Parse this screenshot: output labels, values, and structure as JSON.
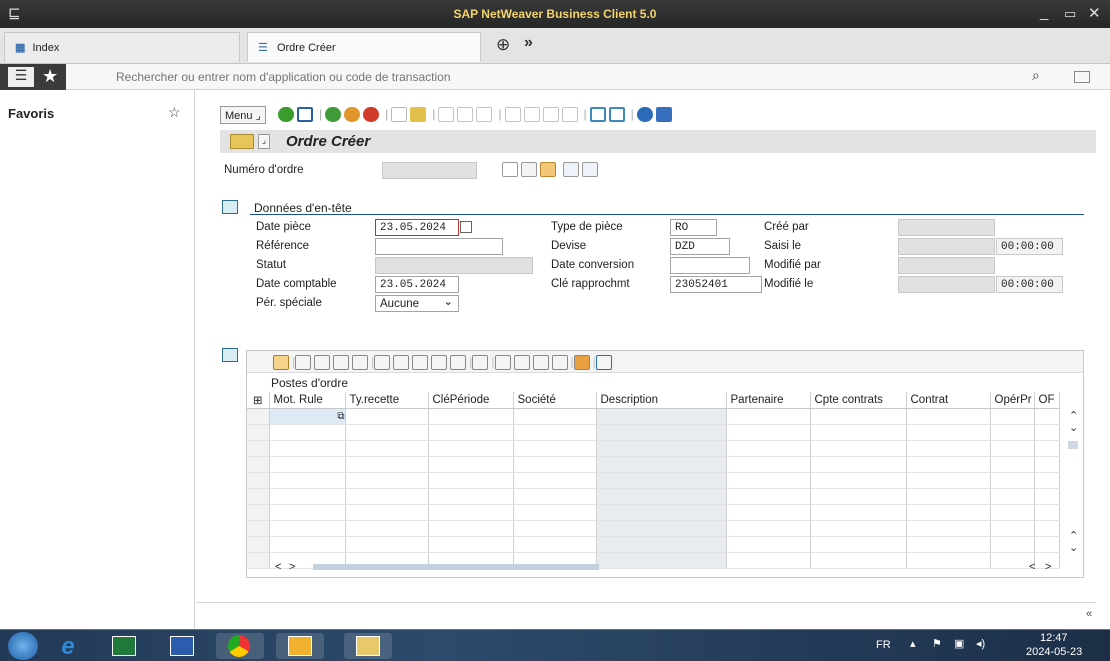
{
  "window": {
    "title": "SAP NetWeaver Business Client 5.0"
  },
  "tabs": [
    {
      "label": "Index"
    },
    {
      "label": "Ordre Créer"
    }
  ],
  "search": {
    "placeholder": "Rechercher ou entrer nom d'application ou code de transaction"
  },
  "sidebar": {
    "title": "Favoris"
  },
  "toolbar": {
    "menu_label": "Menu"
  },
  "page": {
    "title": "Ordre Créer"
  },
  "order": {
    "number_label": "Numéro d'ordre",
    "number_value": ""
  },
  "header": {
    "section_title": "Données d'en-tête",
    "date_piece_label": "Date pièce",
    "date_piece_value": "23.05.2024",
    "reference_label": "Référence",
    "reference_value": "",
    "statut_label": "Statut",
    "statut_value": "",
    "date_comptable_label": "Date comptable",
    "date_comptable_value": "23.05.2024",
    "per_speciale_label": "Pér. spéciale",
    "per_speciale_value": "Aucune",
    "type_piece_label": "Type de pièce",
    "type_piece_value": "RO",
    "devise_label": "Devise",
    "devise_value": "DZD",
    "date_conversion_label": "Date conversion",
    "date_conversion_value": "",
    "cle_rapprochmt_label": "Clé rapprochmt",
    "cle_rapprochmt_value": "23052401",
    "cree_par_label": "Créé par",
    "cree_par_value": "",
    "saisi_le_label": "Saisi le",
    "saisi_le_value": "",
    "saisi_le_time": "00:00:00",
    "modifie_par_label": "Modifié par",
    "modifie_par_value": "",
    "modifie_le_label": "Modifié le",
    "modifie_le_value": "",
    "modifie_le_time": "00:00:00"
  },
  "items": {
    "title": "Postes d'ordre",
    "columns": [
      "Mot. Rule",
      "Ty.recette",
      "CléPériode",
      "Société",
      "Description",
      "Partenaire",
      "Cpte contrats",
      "Contrat",
      "OpérPr",
      "OF"
    ]
  },
  "taskbar": {
    "lang": "FR",
    "time": "12:47",
    "date": "2024-05-23"
  },
  "colors": {
    "titlebar_text": "#f2d46a",
    "accent_blue": "#1a4f9c",
    "highlight": "#dde9f5"
  }
}
